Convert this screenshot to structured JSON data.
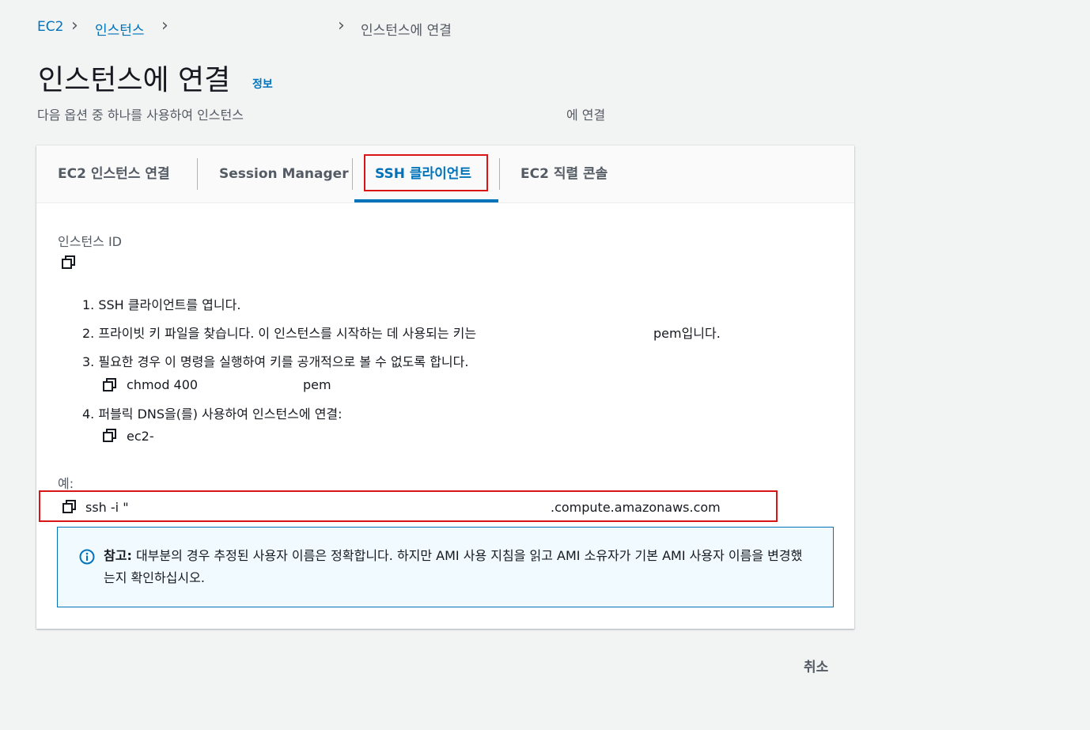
{
  "breadcrumb": {
    "items": [
      "EC2",
      "인스턴스"
    ],
    "current": "인스턴스에 연결"
  },
  "header": {
    "title": "인스턴스에 연결",
    "info": "정보",
    "subtitle_start": "다음 옵션 중 하나를 사용하여 인스턴스",
    "subtitle_end": "에 연결"
  },
  "tabs": [
    {
      "label": "EC2 인스턴스 연결"
    },
    {
      "label": "Session Manager"
    },
    {
      "label": "SSH 클라이언트"
    },
    {
      "label": "EC2 직렬 콘솔"
    }
  ],
  "active_tab": "SSH 클라이언트",
  "instance": {
    "label": "인스턴스 ID"
  },
  "steps": {
    "s1": "1. SSH 클라이언트를 엽니다.",
    "s2_start": "2. 프라이빗 키 파일을 찾습니다. 이 인스턴스를 시작하는 데 사용되는 키는",
    "s2_end": "pem입니다.",
    "s3": "3. 필요한 경우 이 명령을 실행하여 키를 공개적으로 볼 수 없도록 합니다.",
    "s3_cmd_start": "chmod 400",
    "s3_cmd_end": "pem",
    "s4": "4. 퍼블릭 DNS을(를) 사용하여 인스턴스에 연결:",
    "s4_cmd": "ec2-"
  },
  "example": {
    "label": "예:",
    "cmd_start": "ssh -i \"",
    "cmd_end": ".compute.amazonaws.com"
  },
  "note": {
    "label": "참고:",
    "text": "대부분의 경우 추정된 사용자 이름은 정확합니다. 하지만 AMI 사용 지침을 읽고 AMI 소유자가 기본 AMI 사용자 이름을 변경했는지 확인하십시오."
  },
  "footer": {
    "cancel": "취소"
  },
  "colors": {
    "link": "#0073bb",
    "highlight": "#d91515",
    "note_border": "#0073bb"
  },
  "icons": [
    "copy-icon",
    "info-icon",
    "chevron-right-icon"
  ]
}
